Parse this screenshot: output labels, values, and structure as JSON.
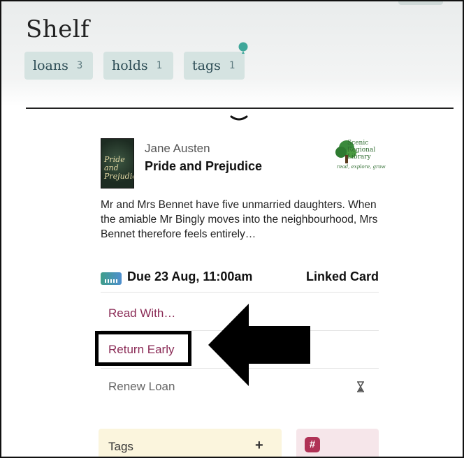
{
  "header": {
    "title": "Shelf",
    "chips": [
      {
        "label": "loans",
        "count": "3"
      },
      {
        "label": "holds",
        "count": "1"
      },
      {
        "label": "tags",
        "count": "1"
      }
    ]
  },
  "loan": {
    "author": "Jane Austen",
    "title": "Pride and Prejudice",
    "cover_text": "Pride and Prejudice",
    "library": {
      "name": "Scenic Regional Library",
      "tagline": "read, explore, grow"
    },
    "blurb": "Mr and Mrs Bennet have five unmarried daughters. When the amiable Mr Bingly moves into the neighbourhood, Mrs Bennet therefore feels entirely…",
    "due": "Due 23 Aug, 11:00am",
    "card": "Linked Card",
    "actions": {
      "read_with": "Read With…",
      "return_early": "Return Early",
      "renew": "Renew Loan"
    }
  },
  "panels": {
    "tags_label": "Tags",
    "tags_add": "+",
    "hash": "#"
  },
  "colors": {
    "chip_bg": "#d5e3e1",
    "action": "#8a2a55",
    "hash_accent": "#b03256"
  }
}
